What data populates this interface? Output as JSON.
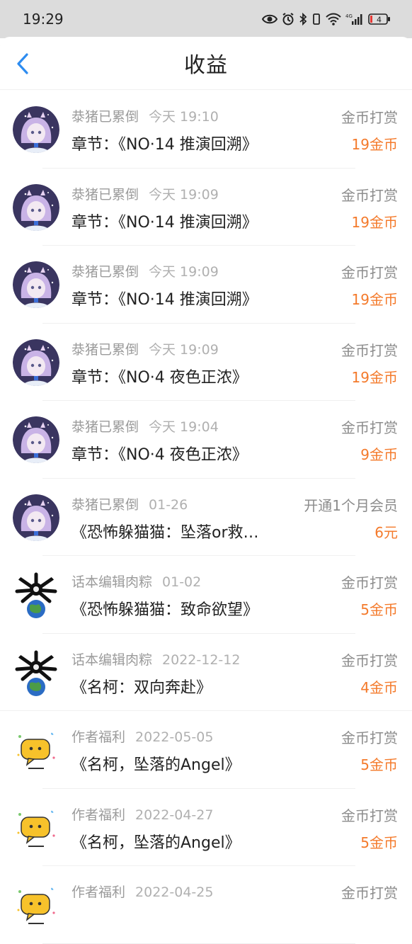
{
  "status_bar": {
    "time": "19:29",
    "network": "4G",
    "battery": "4"
  },
  "header": {
    "title": "收益"
  },
  "items": [
    {
      "avatar": "anime-girl-avatar",
      "name": "㳟猪已累倒",
      "time": "今天 19:10",
      "title": "章节：《NO·14 推演回溯》",
      "type": "金币打赏",
      "amount": "19金币"
    },
    {
      "avatar": "anime-girl-avatar",
      "name": "㳟猪已累倒",
      "time": "今天 19:09",
      "title": "章节：《NO·14 推演回溯》",
      "type": "金币打赏",
      "amount": "19金币"
    },
    {
      "avatar": "anime-girl-avatar",
      "name": "㳟猪已累倒",
      "time": "今天 19:09",
      "title": "章节：《NO·14 推演回溯》",
      "type": "金币打赏",
      "amount": "19金币"
    },
    {
      "avatar": "anime-girl-avatar",
      "name": "㳟猪已累倒",
      "time": "今天 19:09",
      "title": "章节：《NO·4 夜色正浓》",
      "type": "金币打赏",
      "amount": "19金币"
    },
    {
      "avatar": "anime-girl-avatar",
      "name": "㳟猪已累倒",
      "time": "今天 19:04",
      "title": "章节：《NO·4 夜色正浓》",
      "type": "金币打赏",
      "amount": "9金币"
    },
    {
      "avatar": "anime-girl-avatar",
      "name": "㳟猪已累倒",
      "time": "01-26",
      "title": "《恐怖躲猫猫：坠落or救…",
      "type": "开通1个月会员",
      "amount": "6元"
    },
    {
      "avatar": "globe-creature-avatar",
      "name": "话本编辑肉粽",
      "time": "01-02",
      "title": "《恐怖躲猫猫：致命欲望》",
      "type": "金币打赏",
      "amount": "5金币"
    },
    {
      "avatar": "globe-creature-avatar",
      "name": "话本编辑肉粽",
      "time": "2022-12-12",
      "title": "《名柯：双向奔赴》",
      "type": "金币打赏",
      "amount": "4金币"
    },
    {
      "avatar": "yellow-chat-bubble-avatar",
      "name": "作者福利",
      "time": "2022-05-05",
      "title": "《名柯，坠落的Angel》",
      "type": "金币打赏",
      "amount": "5金币"
    },
    {
      "avatar": "yellow-chat-bubble-avatar",
      "name": "作者福利",
      "time": "2022-04-27",
      "title": "《名柯，坠落的Angel》",
      "type": "金币打赏",
      "amount": "5金币"
    },
    {
      "avatar": "yellow-chat-bubble-avatar",
      "name": "作者福利",
      "time": "2022-04-25",
      "title": "",
      "type": "金币打赏",
      "amount": ""
    }
  ],
  "colors": {
    "amount": "#f47a2b",
    "back_arrow": "#2d8cf0"
  }
}
